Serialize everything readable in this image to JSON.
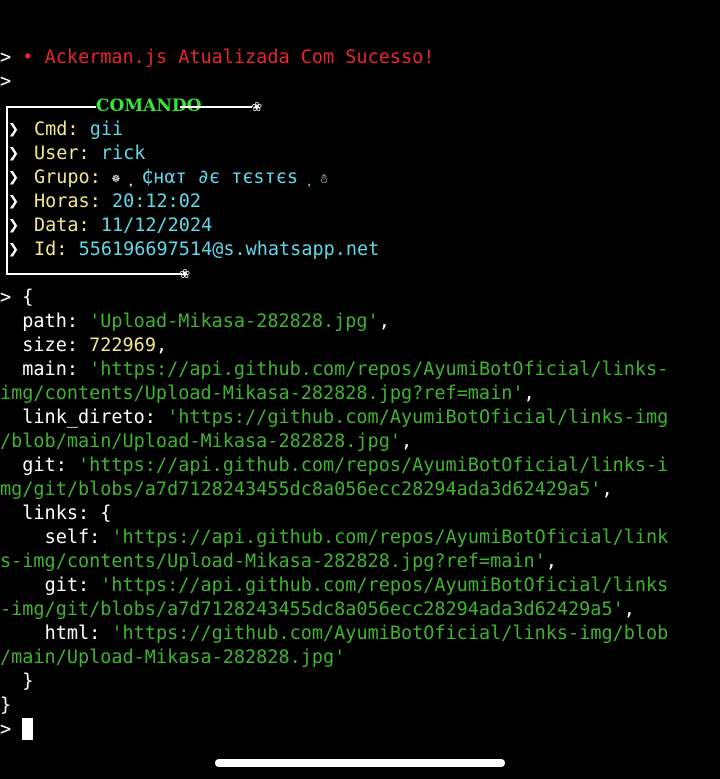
{
  "prompt": ">",
  "status_line": {
    "bullet": "•",
    "message": "Ackerman.js Atualizada Com Sucesso!"
  },
  "box": {
    "title": "COMANDO",
    "corner_glyph": "❀",
    "arrow": "❯",
    "fields": [
      {
        "label": "Cmd:",
        "value": "gii"
      },
      {
        "label": "User:",
        "value": "rick"
      },
      {
        "label": "Grupo:",
        "value": "͎ ₵нαт ∂є тєѕтєѕ ͎",
        "deco_left": "☸",
        "deco_right": "☃"
      },
      {
        "label": "Horas:",
        "value": "20:12:02"
      },
      {
        "label": "Data:",
        "value": "11/12/2024"
      },
      {
        "label": "Id:",
        "value": "556196697514@s.whatsapp.net"
      }
    ]
  },
  "object": {
    "open": "{",
    "close": "}",
    "path_key": "path:",
    "path_val": "'Upload-Mikasa-282828.jpg'",
    "size_key": "size:",
    "size_val": "722969",
    "main_key": "main:",
    "main_val_1": "'https://api.github.com/repos/AyumiBotOficial/links-",
    "main_val_2": "img/contents/Upload-Mikasa-282828.jpg?ref=main'",
    "link_key": "link_direto:",
    "link_val_1": "'https://github.com/AyumiBotOficial/links-img",
    "link_val_2": "/blob/main/Upload-Mikasa-282828.jpg'",
    "git_key": "git:",
    "git_val_1": "'https://api.github.com/repos/AyumiBotOficial/links-i",
    "git_val_2": "mg/git/blobs/a7d7128243455dc8a056ecc28294ada3d62429a5'",
    "links_key": "links:",
    "links_open": "{",
    "links_close": "}",
    "self_key": "self:",
    "self_val_1": "'https://api.github.com/repos/AyumiBotOficial/link",
    "self_val_2": "s-img/contents/Upload-Mikasa-282828.jpg?ref=main'",
    "lgit_key": "git:",
    "lgit_val_1": "'https://api.github.com/repos/AyumiBotOficial/links",
    "lgit_val_2": "-img/git/blobs/a7d7128243455dc8a056ecc28294ada3d62429a5'",
    "html_key": "html:",
    "html_val_1": "'https://github.com/AyumiBotOficial/links-img/blob",
    "html_val_2": "/main/Upload-Mikasa-282828.jpg'"
  },
  "colors": {
    "background": "#000000",
    "error_red": "#e8242d",
    "label_yellow": "#f0e68c",
    "value_cyan": "#5fd7e8",
    "string_green": "#3fb22f",
    "title_green": "#37e636"
  }
}
